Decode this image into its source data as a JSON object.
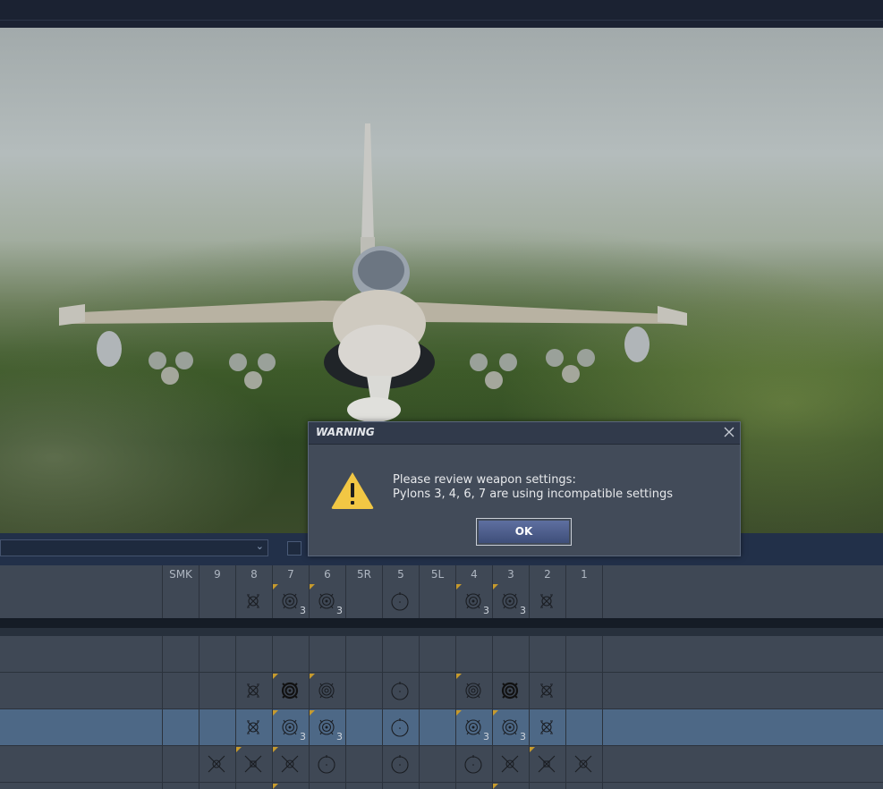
{
  "pylon_headers": [
    "SMK",
    "9",
    "8",
    "7",
    "6",
    "5R",
    "5",
    "5L",
    "4",
    "3",
    "2",
    "1"
  ],
  "dialog": {
    "title": "WARNING",
    "line1": "Please review weapon settings:",
    "line2": "Pylons 3, 4, 6, 7 are using incompatible settings",
    "ok_label": "OK"
  },
  "rows": [
    {
      "name": "summary-row",
      "cells": [
        null,
        null,
        {
          "icon": "cluster"
        },
        {
          "icon": "target",
          "flag": true,
          "count": "3"
        },
        {
          "icon": "target",
          "flag": true,
          "count": "3"
        },
        null,
        {
          "icon": "tank"
        },
        null,
        {
          "icon": "target",
          "flag": true,
          "count": "3"
        },
        {
          "icon": "target",
          "flag": true,
          "count": "3"
        },
        {
          "icon": "cluster"
        },
        null
      ]
    },
    {
      "name": "empty-row",
      "cells": []
    },
    {
      "name": "loadout-row-1",
      "cells": [
        null,
        null,
        {
          "icon": "cluster"
        },
        {
          "icon": "target-bold",
          "flag": true
        },
        {
          "icon": "target-ring",
          "flag": true
        },
        null,
        {
          "icon": "tank"
        },
        null,
        {
          "icon": "target-ring",
          "flag": true
        },
        {
          "icon": "target-bold"
        },
        {
          "icon": "cluster"
        },
        null
      ]
    },
    {
      "name": "loadout-row-2",
      "cells": [
        null,
        null,
        {
          "icon": "cluster"
        },
        {
          "icon": "target",
          "flag": true,
          "count": "3"
        },
        {
          "icon": "target",
          "flag": true,
          "count": "3"
        },
        null,
        {
          "icon": "tank"
        },
        null,
        {
          "icon": "target",
          "flag": true,
          "count": "3"
        },
        {
          "icon": "target",
          "flag": true,
          "count": "3"
        },
        {
          "icon": "cluster"
        },
        null
      ]
    },
    {
      "name": "loadout-row-3",
      "cells": [
        null,
        {
          "icon": "cross"
        },
        {
          "icon": "cross-square",
          "flag": true
        },
        {
          "icon": "cross",
          "flag": true
        },
        {
          "icon": "tank"
        },
        null,
        {
          "icon": "tank"
        },
        null,
        {
          "icon": "tank"
        },
        {
          "icon": "cross"
        },
        {
          "icon": "cross-square",
          "flag": true
        },
        {
          "icon": "cross"
        }
      ]
    }
  ],
  "colors": {
    "selected_row": "#4d6886",
    "warning_yellow": "#f2c744",
    "flag": "#c69a2d"
  }
}
